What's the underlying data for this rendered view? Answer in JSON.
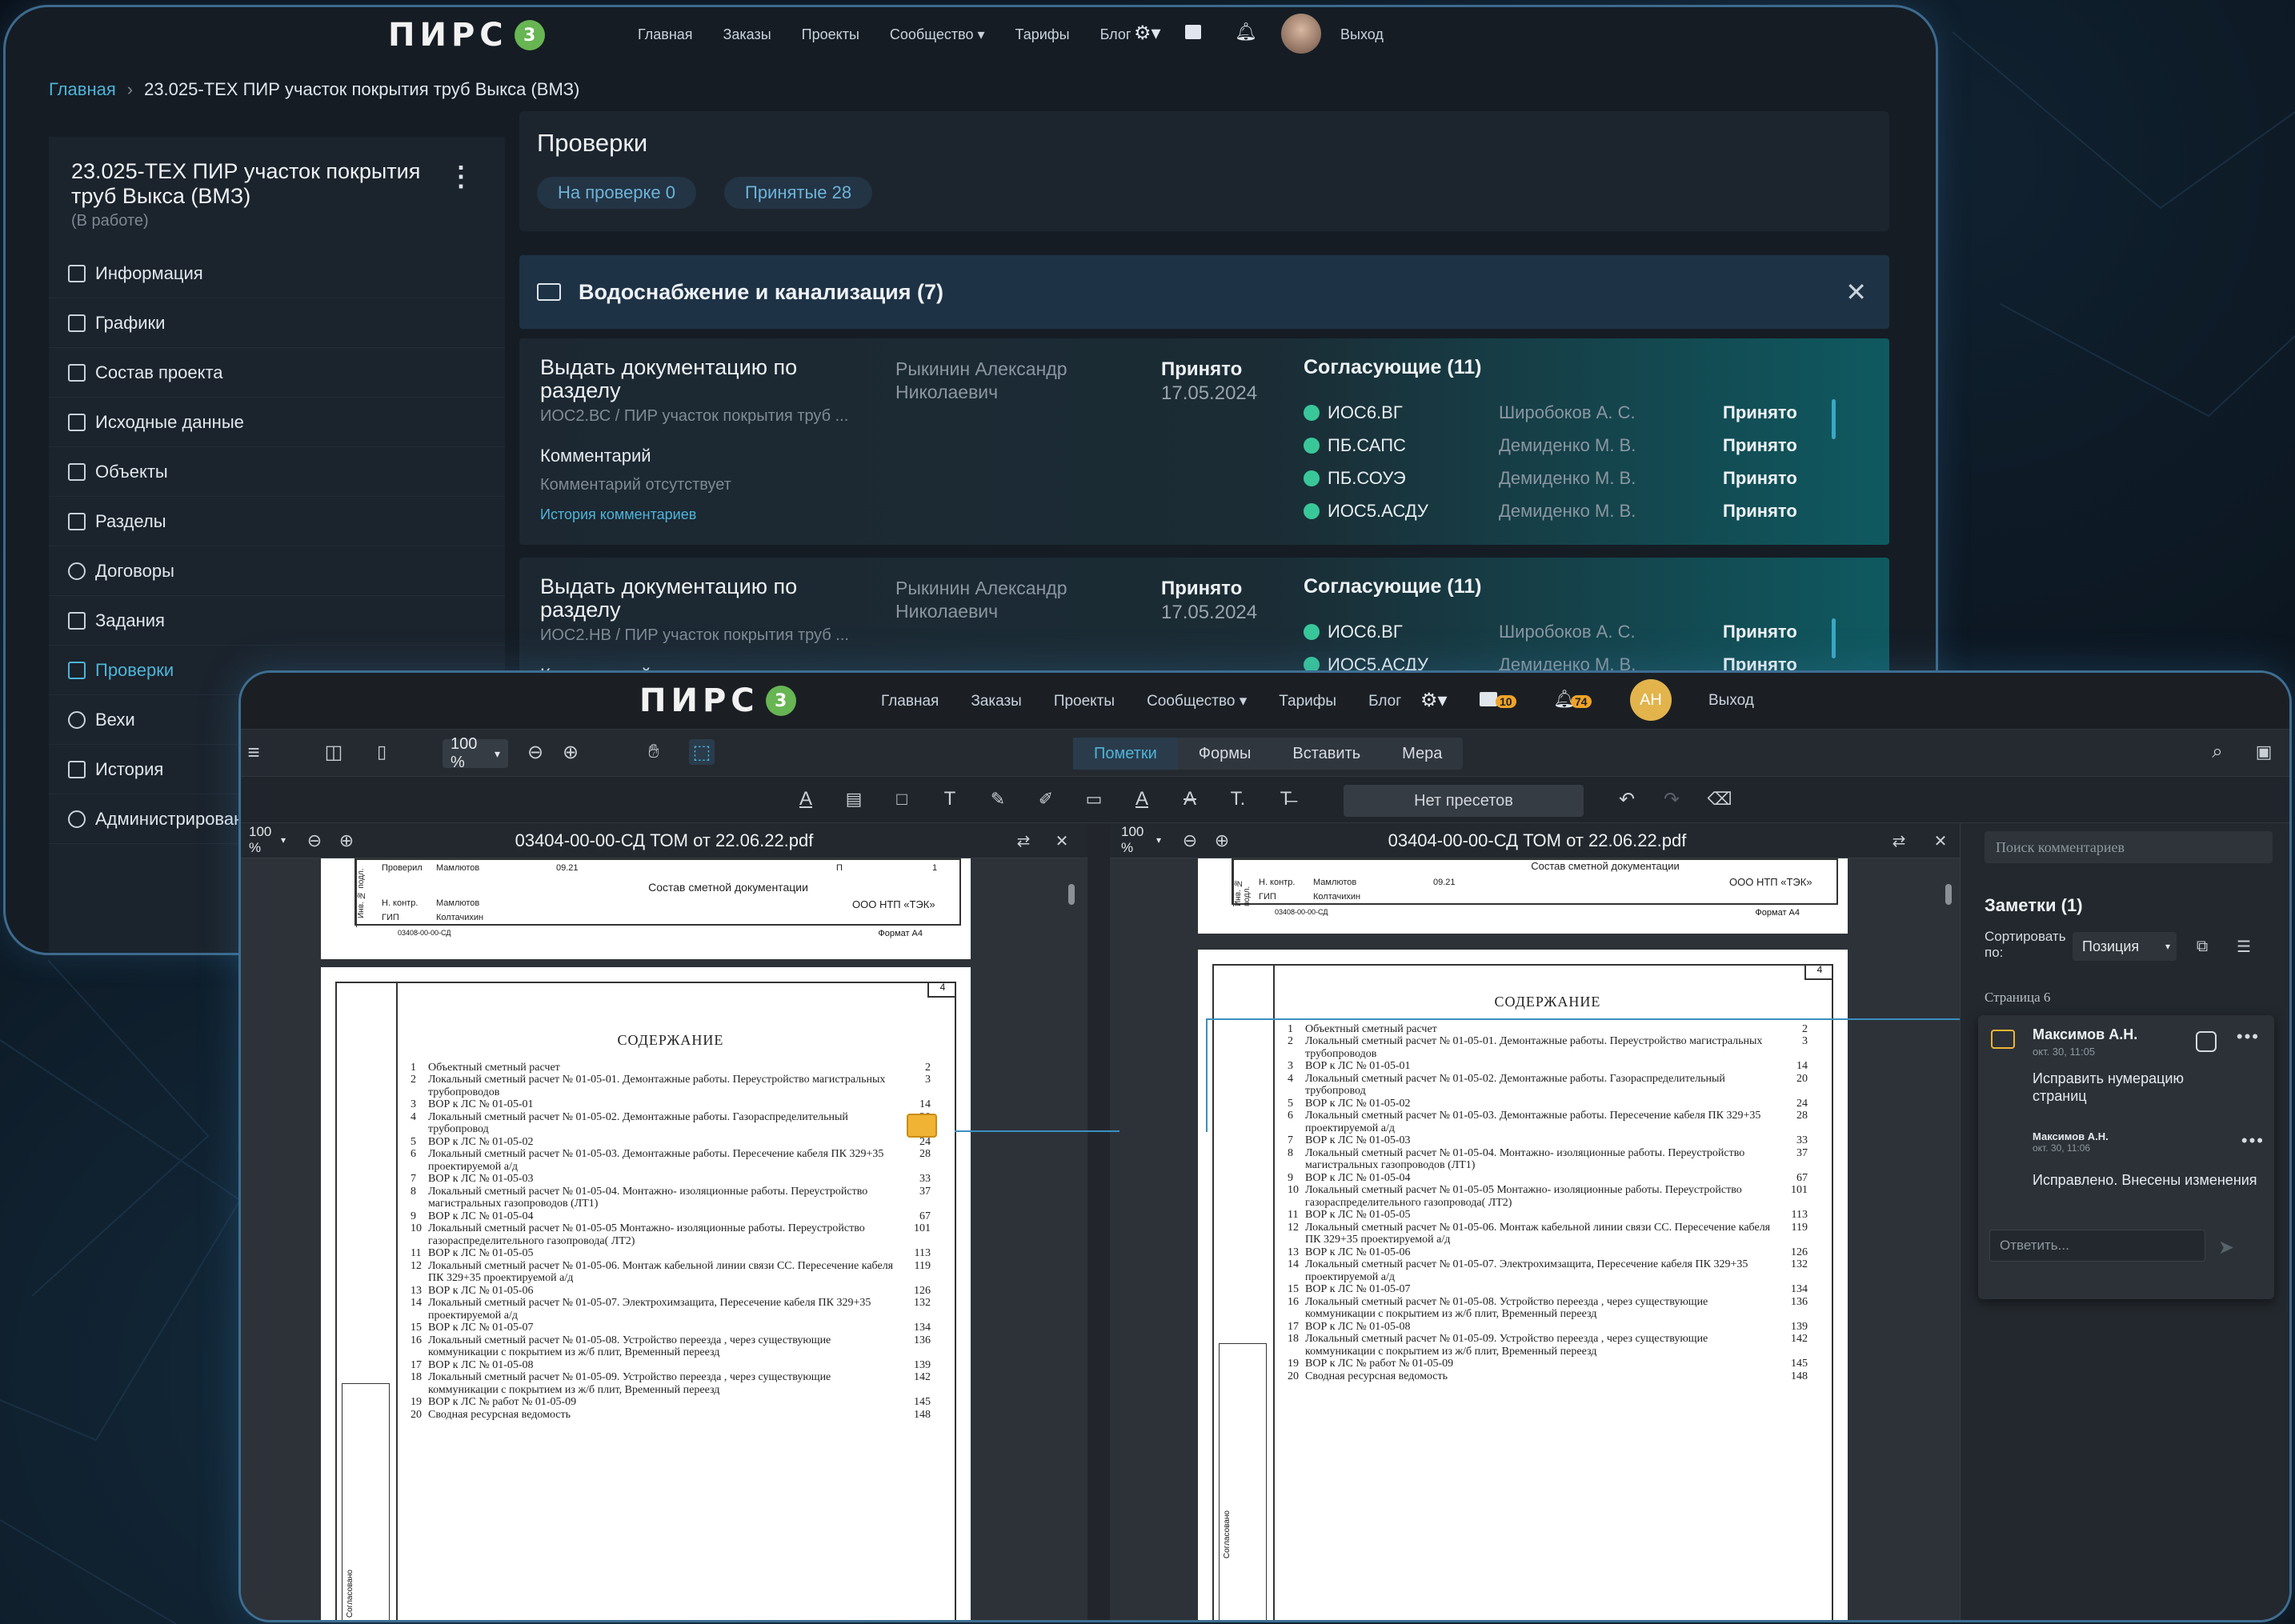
{
  "app1": {
    "logo": "ПИРС",
    "logo_badge": "3",
    "nav": [
      "Главная",
      "Заказы",
      "Проекты",
      "Сообщество",
      "Тарифы",
      "Блог"
    ],
    "logout": "Выход",
    "breadcrumb": {
      "home": "Главная",
      "sep": "›",
      "current": "23.025-ТЕХ ПИР участок покрытия труб Выкса (ВМЗ)"
    },
    "project": {
      "title": "23.025-ТЕХ ПИР участок покрытия труб Выкса (ВМЗ)",
      "status": "(В работе)"
    },
    "menu": [
      "Информация",
      "Графики",
      "Состав проекта",
      "Исходные данные",
      "Объекты",
      "Разделы",
      "Договоры",
      "Задания",
      "Проверки",
      "Вехи",
      "История",
      "Администрирование"
    ],
    "checks": {
      "title": "Проверки",
      "tab_review": "На проверке 0",
      "tab_accepted": "Принятые 28",
      "section": "Водоснабжение и канализация (7)",
      "cards": [
        {
          "title": "Выдать документацию по разделу",
          "sub": "ИОС2.ВС / ПИР участок покрытия труб ...",
          "comment_label": "Комментарий",
          "comment_value": "Комментарий отсутствует",
          "history": "История комментариев",
          "author": "Рыкинин Александр Николаевич",
          "status": "Принято",
          "date": "17.05.2024",
          "approvers_title": "Согласующие (11)",
          "approvers": [
            {
              "code": "ИОС6.ВГ",
              "person": "Широбоков А. С.",
              "status": "Принято"
            },
            {
              "code": "ПБ.САПС",
              "person": "Демиденко М. В.",
              "status": "Принято"
            },
            {
              "code": "ПБ.СОУЭ",
              "person": "Демиденко М. В.",
              "status": "Принято"
            },
            {
              "code": "ИОС5.АСДУ",
              "person": "Демиденко М. В.",
              "status": "Принято"
            }
          ]
        },
        {
          "title": "Выдать документацию по разделу",
          "sub": "ИОС2.НВ / ПИР участок покрытия труб ...",
          "comment_label": "Комментарий",
          "author": "Рыкинин Александр Николаевич",
          "status": "Принято",
          "date": "17.05.2024",
          "approvers_title": "Согласующие (11)",
          "approvers": [
            {
              "code": "ИОС6.ВГ",
              "person": "Широбоков А. С.",
              "status": "Принято"
            },
            {
              "code": "ИОС5.АСДУ",
              "person": "Демиденко М. В.",
              "status": "Принято"
            }
          ]
        }
      ]
    }
  },
  "app2": {
    "logo": "ПИРС",
    "logo_badge": "3",
    "nav": [
      "Главная",
      "Заказы",
      "Проекты",
      "Сообщество",
      "Тарифы",
      "Блог"
    ],
    "chat_badge": "10",
    "bell_badge": "74",
    "avatar": "АН",
    "logout": "Выход",
    "zoom": "100 %",
    "modes": [
      "Пометки",
      "Формы",
      "Вставить",
      "Мера"
    ],
    "preset": "Нет пресетов",
    "left_file": "03404-00-00-СД ТОМ от 22.06.22.pdf",
    "right_file": "03404-00-00-СД ТОМ от 22.06.22.pdf",
    "pane_zoom": "100 %",
    "stamp": {
      "row1": "Проверил",
      "name1": "Мамлютов",
      "date": "09.21",
      "row2": "Н. контр.",
      "row3": "ГИП",
      "name3": "Колтачихин",
      "doc": "Состав сметной документации",
      "org": "ООО НТП «ТЭК»",
      "stage": "П",
      "sheet": "1",
      "code": "03408-00-00-СД",
      "format": "Формат А4",
      "page_no": "4",
      "side1": "Инв. № подл.",
      "side2": "Согласовано"
    },
    "toc": {
      "heading": "СОДЕРЖАНИЕ",
      "items": [
        {
          "n": "1",
          "t": "Объектный сметный расчет",
          "p": "2"
        },
        {
          "n": "2",
          "t": "Локальный сметный расчет № 01-05-01. Демонтажные работы. Переустройство магистральных трубопроводов",
          "p": "3"
        },
        {
          "n": "3",
          "t": "ВОР к ЛС № 01-05-01",
          "p": "14"
        },
        {
          "n": "4",
          "t": "Локальный сметный расчет № 01-05-02. Демонтажные работы. Газораспределительный трубопровод",
          "p": "20"
        },
        {
          "n": "5",
          "t": "ВОР к ЛС № 01-05-02",
          "p": "24"
        },
        {
          "n": "6",
          "t": "Локальный сметный расчет № 01-05-03. Демонтажные работы. Пересечение кабеля ПК 329+35 проектируемой а/д",
          "p": "28"
        },
        {
          "n": "7",
          "t": "ВОР к ЛС № 01-05-03",
          "p": "33"
        },
        {
          "n": "8",
          "t": "Локальный сметный расчет № 01-05-04. Монтажно- изоляционные работы. Переустройство магистральных газопроводов (ЛТ1)",
          "p": "37"
        },
        {
          "n": "9",
          "t": "ВОР к ЛС № 01-05-04",
          "p": "67"
        },
        {
          "n": "10",
          "t": "Локальный сметный расчет № 01-05-05 Монтажно- изоляционные работы. Переустройство газораспределительного газопровода( ЛТ2)",
          "p": "101"
        },
        {
          "n": "11",
          "t": "ВОР к ЛС № 01-05-05",
          "p": "113"
        },
        {
          "n": "12",
          "t": "Локальный сметный расчет № 01-05-06. Монтаж кабельной линии связи СС. Пересечение кабеля ПК 329+35 проектируемой а/д",
          "p": "119"
        },
        {
          "n": "13",
          "t": "ВОР к ЛС № 01-05-06",
          "p": "126"
        },
        {
          "n": "14",
          "t": "Локальный сметный расчет № 01-05-07. Электрохимзащита, Пересечение кабеля ПК 329+35 проектируемой а/д",
          "p": "132"
        },
        {
          "n": "15",
          "t": "ВОР к ЛС № 01-05-07",
          "p": "134"
        },
        {
          "n": "16",
          "t": "Локальный сметный расчет № 01-05-08. Устройство переезда , через существующие коммуникации с покрытием из ж/б плит, Временный переезд",
          "p": "136"
        },
        {
          "n": "17",
          "t": "ВОР к ЛС № 01-05-08",
          "p": "139"
        },
        {
          "n": "18",
          "t": "Локальный сметный расчет № 01-05-09. Устройство переезда , через существующие коммуникации с покрытием из ж/б плит, Временный переезд",
          "p": "142"
        },
        {
          "n": "19",
          "t": "ВОР к ЛС № работ № 01-05-09",
          "p": "145"
        },
        {
          "n": "20",
          "t": "Сводная ресурсная ведомость",
          "p": "148"
        }
      ]
    },
    "notes": {
      "search": "Поиск комментариев",
      "title": "Заметки (1)",
      "sort_label": "Сортировать по:",
      "sort_value": "Позиция",
      "page_label": "Страница 6",
      "note": {
        "author": "Максимов А.Н.",
        "date": "окт. 30, 11:05",
        "text": "Исправить нумерацию страниц",
        "reply_author": "Максимов А.Н.",
        "reply_date": "окт. 30, 11:06",
        "reply_text": "Исправлено. Внесены изменения"
      },
      "reply_placeholder": "Ответить..."
    }
  }
}
